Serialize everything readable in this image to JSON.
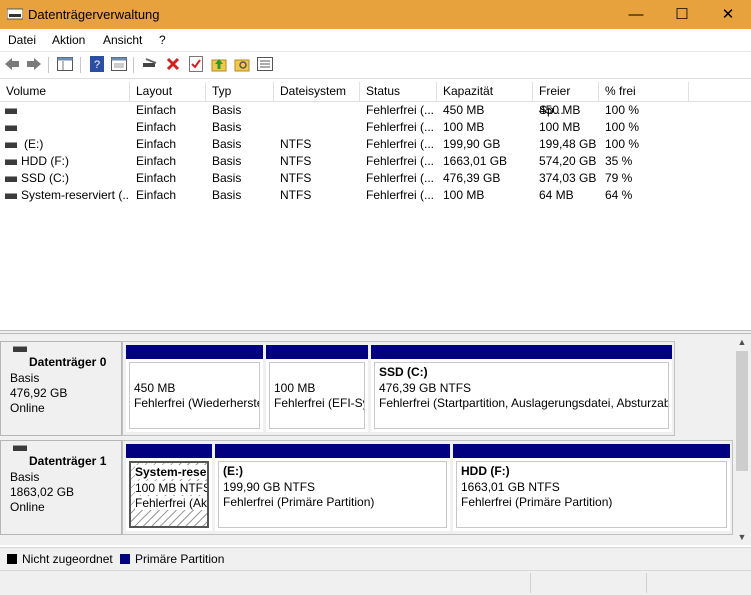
{
  "window": {
    "title": "Datenträgerverwaltung",
    "minimize": "—",
    "maximize": "☐",
    "close": "✕"
  },
  "menu": [
    "Datei",
    "Aktion",
    "Ansicht",
    "?"
  ],
  "list": {
    "headers": [
      "Volume",
      "Layout",
      "Typ",
      "Dateisystem",
      "Status",
      "Kapazität",
      "Freier Sp...",
      "% frei"
    ],
    "rows": [
      {
        "volume": "",
        "layout": "Einfach",
        "typ": "Basis",
        "fs": "",
        "status": "Fehlerfrei (...",
        "cap": "450 MB",
        "free": "450 MB",
        "pct": "100 %"
      },
      {
        "volume": "",
        "layout": "Einfach",
        "typ": "Basis",
        "fs": "",
        "status": "Fehlerfrei (...",
        "cap": "100 MB",
        "free": "100 MB",
        "pct": "100 %"
      },
      {
        "volume": "(E:)",
        "layout": "Einfach",
        "typ": "Basis",
        "fs": "NTFS",
        "status": "Fehlerfrei (...",
        "cap": "199,90 GB",
        "free": "199,48 GB",
        "pct": "100 %"
      },
      {
        "volume": "HDD (F:)",
        "layout": "Einfach",
        "typ": "Basis",
        "fs": "NTFS",
        "status": "Fehlerfrei (...",
        "cap": "1663,01 GB",
        "free": "574,20 GB",
        "pct": "35 %"
      },
      {
        "volume": "SSD (C:)",
        "layout": "Einfach",
        "typ": "Basis",
        "fs": "NTFS",
        "status": "Fehlerfrei (...",
        "cap": "476,39 GB",
        "free": "374,03 GB",
        "pct": "79 %"
      },
      {
        "volume": "System-reserviert (...",
        "layout": "Einfach",
        "typ": "Basis",
        "fs": "NTFS",
        "status": "Fehlerfrei (...",
        "cap": "100 MB",
        "free": "64 MB",
        "pct": "64 %"
      }
    ]
  },
  "disks": [
    {
      "name": "Datenträger 0",
      "type": "Basis",
      "size": "476,92 GB",
      "state": "Online",
      "parts": [
        {
          "title": "",
          "size": "450 MB",
          "status": "Fehlerfrei (Wiederherste"
        },
        {
          "title": "",
          "size": "100 MB",
          "status": "Fehlerfrei (EFI-Sy"
        },
        {
          "title": "SSD  (C:)",
          "size": "476,39 GB NTFS",
          "status": "Fehlerfrei (Startpartition, Auslagerungsdatei, Absturzab"
        }
      ]
    },
    {
      "name": "Datenträger 1",
      "type": "Basis",
      "size": "1863,02 GB",
      "state": "Online",
      "parts": [
        {
          "title": "System-reser",
          "size": "100 MB NTFS",
          "status": "Fehlerfrei (Akt"
        },
        {
          "title": "(E:)",
          "size": "199,90 GB NTFS",
          "status": "Fehlerfrei (Primäre Partition)"
        },
        {
          "title": "HDD  (F:)",
          "size": "1663,01 GB NTFS",
          "status": "Fehlerfrei (Primäre Partition)"
        }
      ]
    }
  ],
  "legend": [
    {
      "label": "Nicht zugeordnet",
      "color": "#000000"
    },
    {
      "label": "Primäre Partition",
      "color": "#000080"
    }
  ],
  "colors": {
    "titlebar": "#E8A23D",
    "partition_bar": "#000080"
  },
  "toolbar_icons": [
    "back-icon",
    "forward-icon",
    "properties-grid-icon",
    "help-icon",
    "console-icon",
    "connect-icon",
    "delete-icon",
    "properties-check-icon",
    "up-folder-icon",
    "search-folder-icon",
    "list-view-icon"
  ]
}
